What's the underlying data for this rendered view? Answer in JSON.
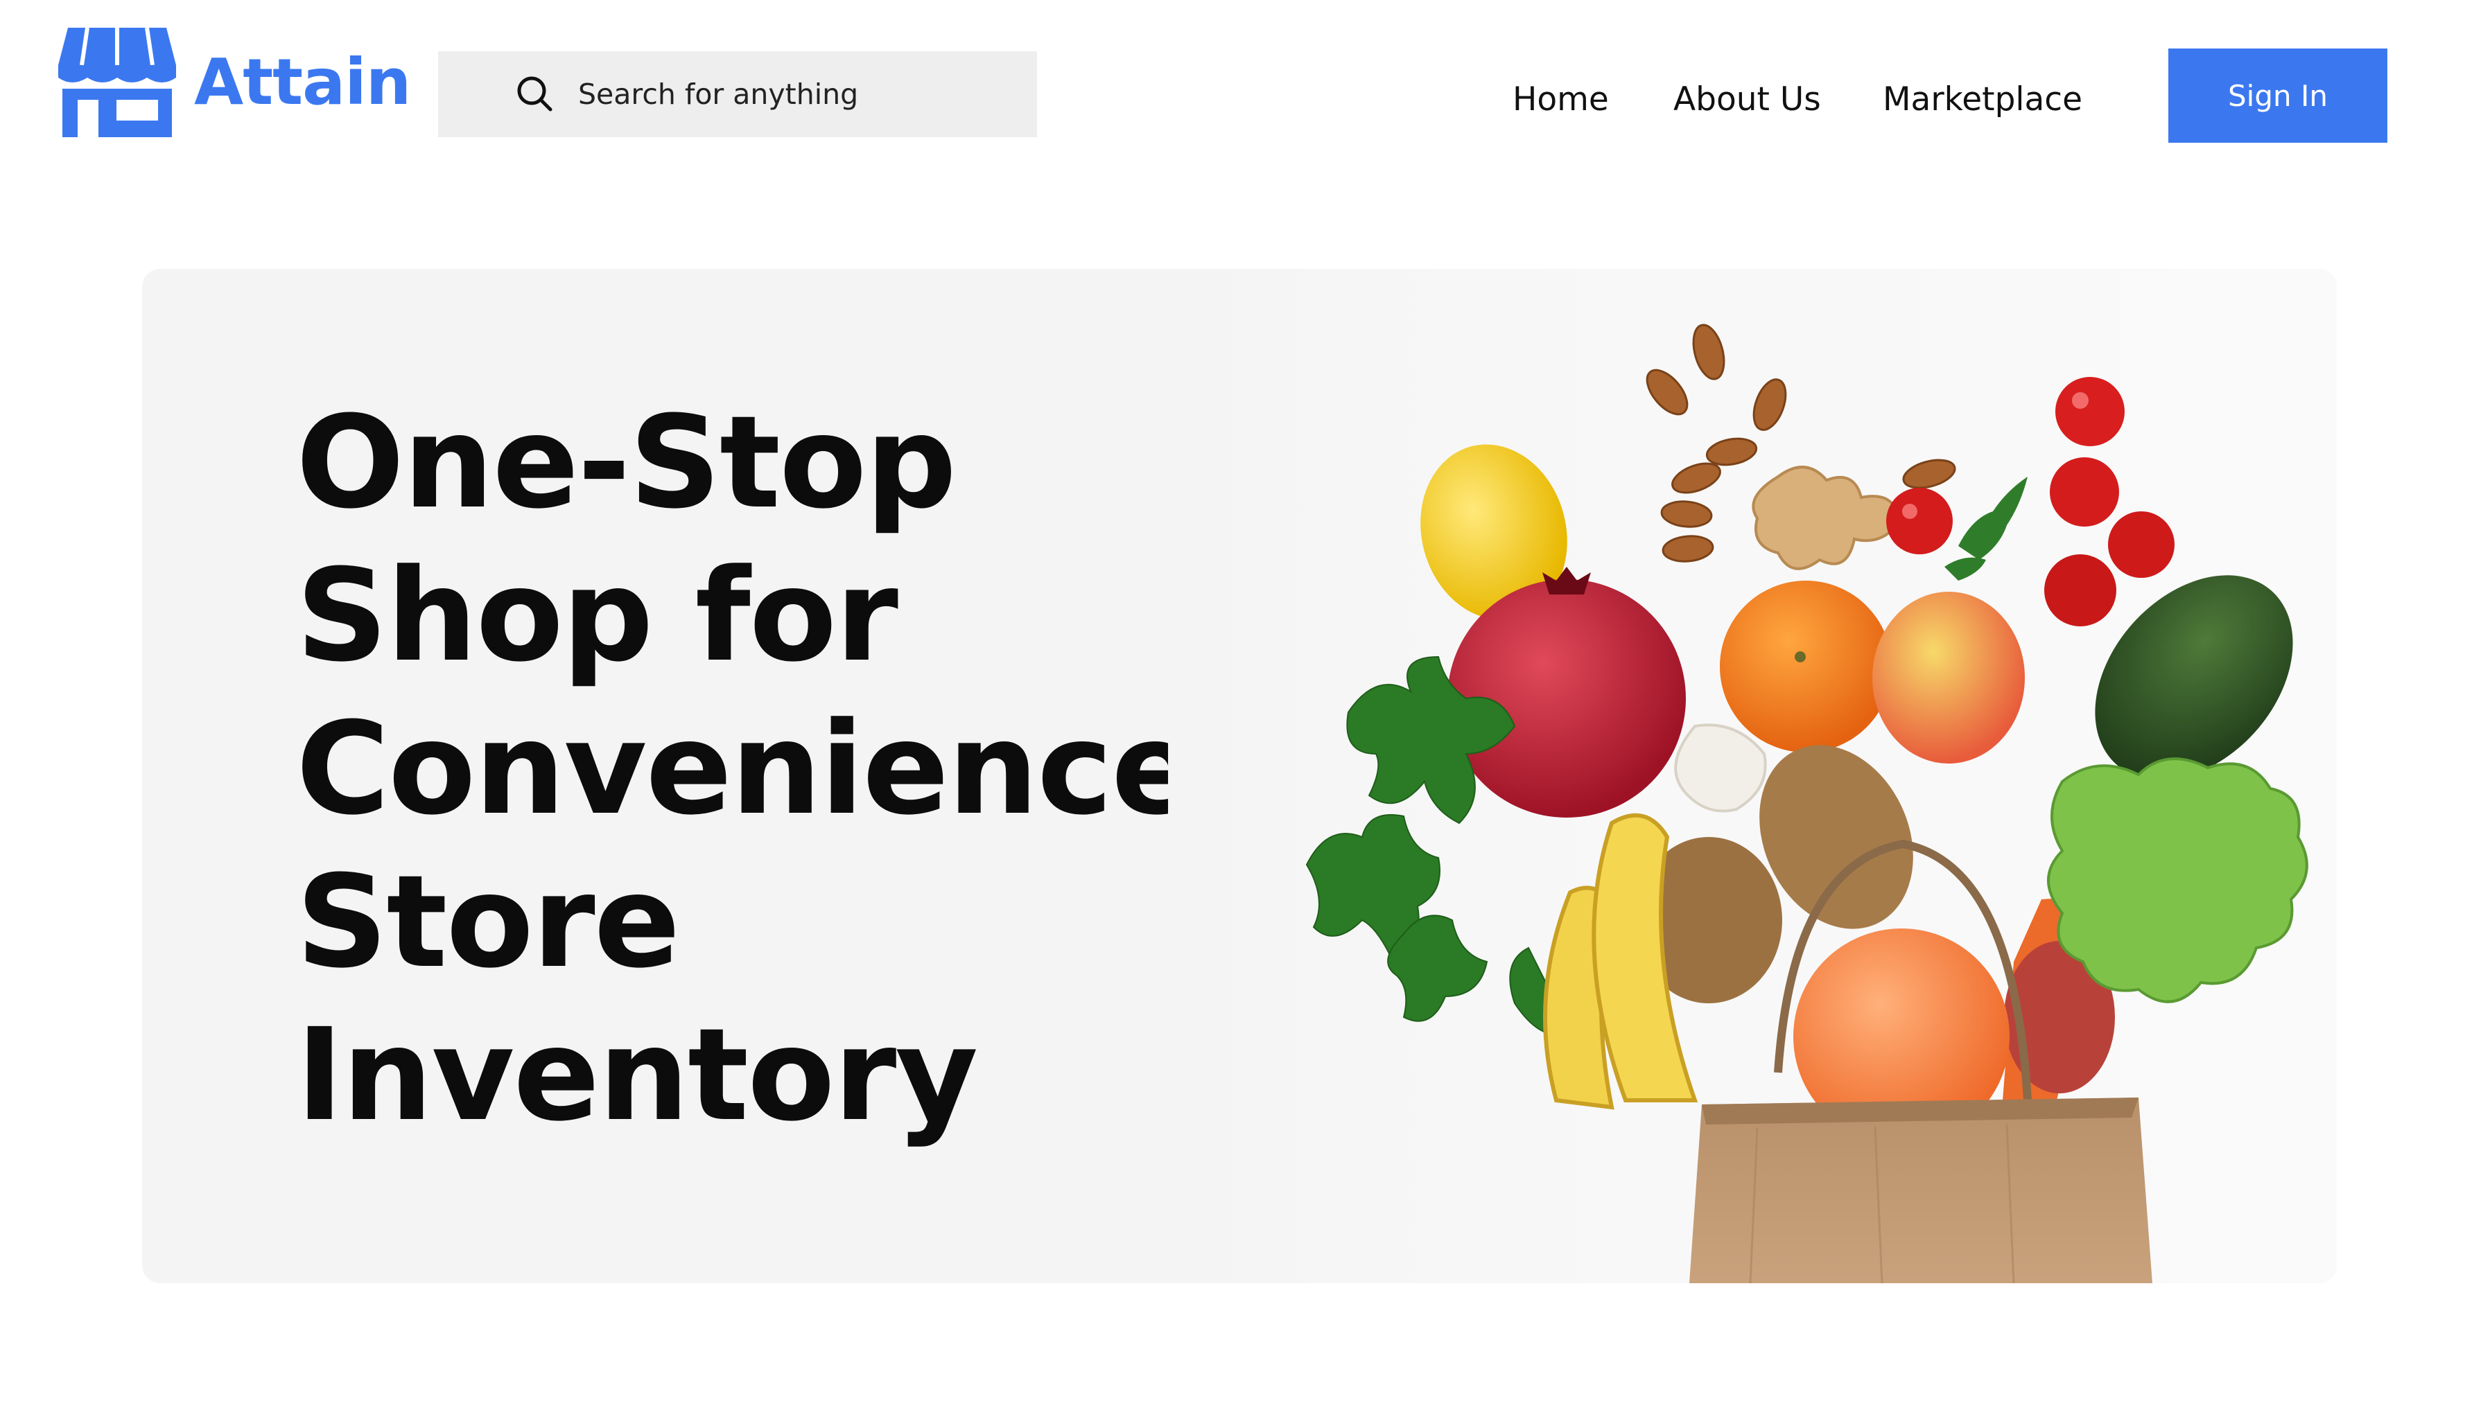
{
  "header": {
    "brand": "Attain",
    "logo_icon": "storefront-icon",
    "search": {
      "placeholder": "Search for anything",
      "icon": "search-icon"
    },
    "nav": [
      {
        "label": "Home"
      },
      {
        "label": "About Us"
      },
      {
        "label": "Marketplace"
      }
    ],
    "signin_label": "Sign In"
  },
  "hero": {
    "title_lines": [
      "One-Stop",
      "Shop for",
      "Convenience",
      "Store",
      "Inventory"
    ],
    "image_subject": "grocery-bag-icon"
  },
  "colors": {
    "brand_blue": "#3b78f0",
    "search_bg": "#eeeeee",
    "hero_bg": "#f4f4f4",
    "text": "#0c0c0c"
  }
}
